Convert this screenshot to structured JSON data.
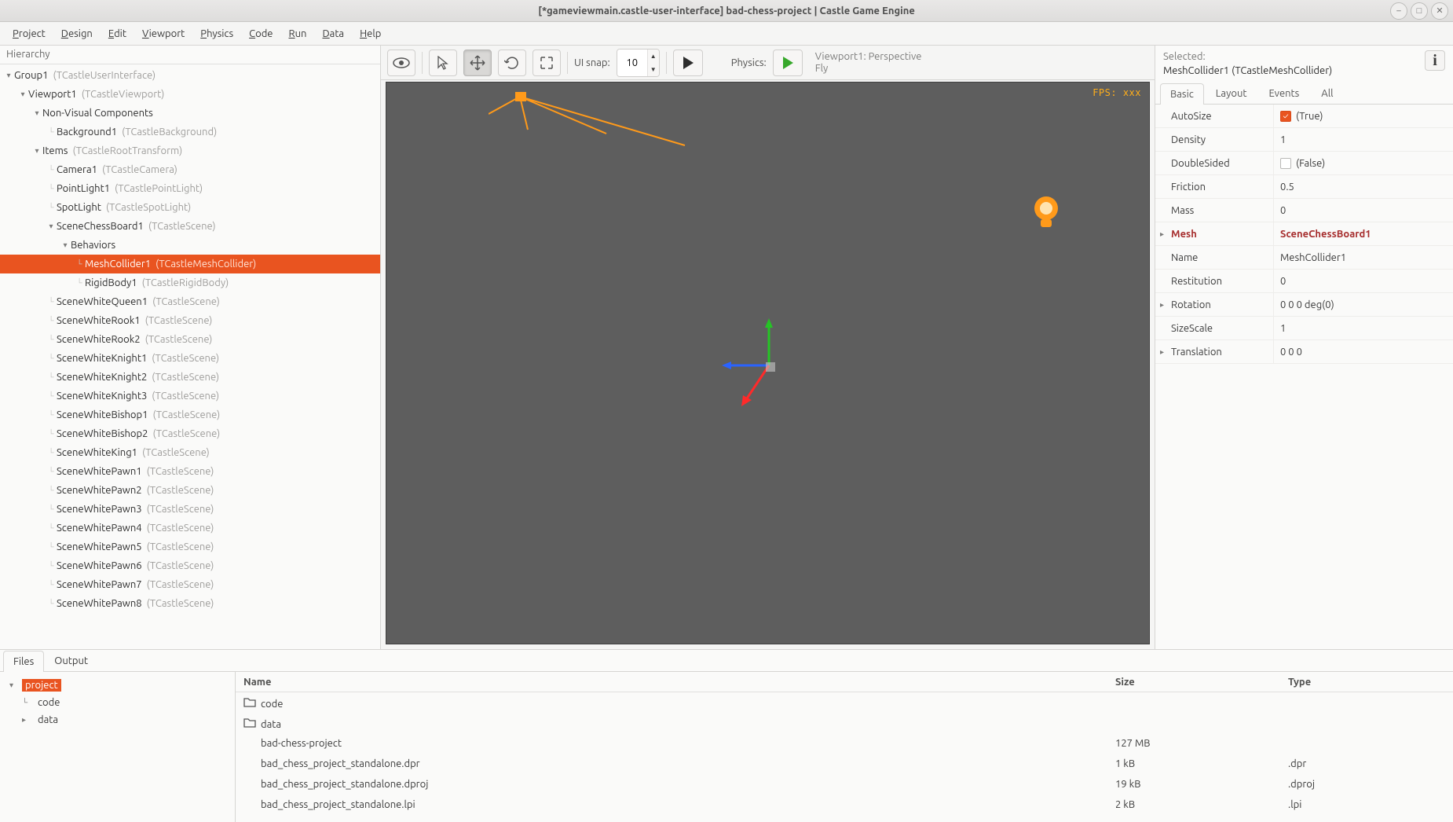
{
  "window": {
    "title": "[*gameviewmain.castle-user-interface] bad-chess-project | Castle Game Engine"
  },
  "menu": [
    "Project",
    "Design",
    "Edit",
    "Viewport",
    "Physics",
    "Code",
    "Run",
    "Data",
    "Help"
  ],
  "hierarchy": {
    "title": "Hierarchy",
    "nodes": [
      {
        "d": 0,
        "tg": true,
        "n": "Group1",
        "t": "(TCastleUserInterface)"
      },
      {
        "d": 1,
        "tg": true,
        "n": "Viewport1",
        "t": "(TCastleViewport)"
      },
      {
        "d": 2,
        "tg": true,
        "n": "Non-Visual Components",
        "t": ""
      },
      {
        "d": 3,
        "tg": false,
        "leaf": true,
        "n": "Background1",
        "t": "(TCastleBackground)"
      },
      {
        "d": 2,
        "tg": true,
        "n": "Items",
        "t": "(TCastleRootTransform)"
      },
      {
        "d": 3,
        "tg": false,
        "leaf": true,
        "n": "Camera1",
        "t": "(TCastleCamera)"
      },
      {
        "d": 3,
        "tg": false,
        "leaf": true,
        "n": "PointLight1",
        "t": "(TCastlePointLight)"
      },
      {
        "d": 3,
        "tg": false,
        "leaf": true,
        "n": "SpotLight",
        "t": "(TCastleSpotLight)"
      },
      {
        "d": 3,
        "tg": true,
        "n": "SceneChessBoard1",
        "t": "(TCastleScene)"
      },
      {
        "d": 4,
        "tg": true,
        "n": "Behaviors",
        "t": ""
      },
      {
        "d": 5,
        "tg": false,
        "leaf": true,
        "sel": true,
        "n": "MeshCollider1",
        "t": "(TCastleMeshCollider)"
      },
      {
        "d": 5,
        "tg": false,
        "leaf": true,
        "n": "RigidBody1",
        "t": "(TCastleRigidBody)"
      },
      {
        "d": 3,
        "tg": false,
        "leaf": true,
        "n": "SceneWhiteQueen1",
        "t": "(TCastleScene)"
      },
      {
        "d": 3,
        "tg": false,
        "leaf": true,
        "n": "SceneWhiteRook1",
        "t": "(TCastleScene)"
      },
      {
        "d": 3,
        "tg": false,
        "leaf": true,
        "n": "SceneWhiteRook2",
        "t": "(TCastleScene)"
      },
      {
        "d": 3,
        "tg": false,
        "leaf": true,
        "n": "SceneWhiteKnight1",
        "t": "(TCastleScene)"
      },
      {
        "d": 3,
        "tg": false,
        "leaf": true,
        "n": "SceneWhiteKnight2",
        "t": "(TCastleScene)"
      },
      {
        "d": 3,
        "tg": false,
        "leaf": true,
        "n": "SceneWhiteKnight3",
        "t": "(TCastleScene)"
      },
      {
        "d": 3,
        "tg": false,
        "leaf": true,
        "n": "SceneWhiteBishop1",
        "t": "(TCastleScene)"
      },
      {
        "d": 3,
        "tg": false,
        "leaf": true,
        "n": "SceneWhiteBishop2",
        "t": "(TCastleScene)"
      },
      {
        "d": 3,
        "tg": false,
        "leaf": true,
        "n": "SceneWhiteKing1",
        "t": "(TCastleScene)"
      },
      {
        "d": 3,
        "tg": false,
        "leaf": true,
        "n": "SceneWhitePawn1",
        "t": "(TCastleScene)"
      },
      {
        "d": 3,
        "tg": false,
        "leaf": true,
        "n": "SceneWhitePawn2",
        "t": "(TCastleScene)"
      },
      {
        "d": 3,
        "tg": false,
        "leaf": true,
        "n": "SceneWhitePawn3",
        "t": "(TCastleScene)"
      },
      {
        "d": 3,
        "tg": false,
        "leaf": true,
        "n": "SceneWhitePawn4",
        "t": "(TCastleScene)"
      },
      {
        "d": 3,
        "tg": false,
        "leaf": true,
        "n": "SceneWhitePawn5",
        "t": "(TCastleScene)"
      },
      {
        "d": 3,
        "tg": false,
        "leaf": true,
        "n": "SceneWhitePawn6",
        "t": "(TCastleScene)"
      },
      {
        "d": 3,
        "tg": false,
        "leaf": true,
        "n": "SceneWhitePawn7",
        "t": "(TCastleScene)"
      },
      {
        "d": 3,
        "tg": false,
        "leaf": true,
        "n": "SceneWhitePawn8",
        "t": "(TCastleScene)"
      }
    ]
  },
  "toolbar": {
    "ui_snap_label": "UI snap:",
    "ui_snap_value": "10",
    "physics_label": "Physics:",
    "vp_info_line1": "Viewport1: Perspective",
    "vp_info_line2": "Fly"
  },
  "viewport": {
    "fps_label": "FPS: xxx",
    "scene_hint": ""
  },
  "inspector": {
    "selected_label": "Selected:",
    "selected_value": "MeshCollider1 (TCastleMeshCollider)",
    "tabs": [
      "Basic",
      "Layout",
      "Events",
      "All"
    ],
    "props": [
      {
        "n": "AutoSize",
        "v": "(True)",
        "chk": true,
        "chkon": true
      },
      {
        "n": "Density",
        "v": "1"
      },
      {
        "n": "DoubleSided",
        "v": "(False)",
        "chk": true,
        "chkon": false
      },
      {
        "n": "Friction",
        "v": "0.5"
      },
      {
        "n": "Mass",
        "v": "0"
      },
      {
        "n": "Mesh",
        "v": "SceneChessBoard1",
        "hl": true,
        "exp": true
      },
      {
        "n": "Name",
        "v": "MeshCollider1"
      },
      {
        "n": "Restitution",
        "v": "0"
      },
      {
        "n": "Rotation",
        "v": "0 0 0 deg(0)",
        "exp": true
      },
      {
        "n": "SizeScale",
        "v": "1"
      },
      {
        "n": "Translation",
        "v": "0 0 0",
        "exp": true
      }
    ]
  },
  "bottom": {
    "tabs": [
      "Files",
      "Output"
    ],
    "folders": [
      {
        "d": 0,
        "n": "project",
        "sel": true
      },
      {
        "d": 1,
        "n": "code",
        "leaf": true
      },
      {
        "d": 1,
        "n": "data",
        "exp": true
      }
    ],
    "headers": {
      "name": "Name",
      "size": "Size",
      "type": "Type"
    },
    "files": [
      {
        "n": "code",
        "folder": true,
        "s": "",
        "t": ""
      },
      {
        "n": "data",
        "folder": true,
        "s": "",
        "t": ""
      },
      {
        "n": "bad-chess-project",
        "s": "127 MB",
        "t": ""
      },
      {
        "n": "bad_chess_project_standalone.dpr",
        "s": "1 kB",
        "t": ".dpr"
      },
      {
        "n": "bad_chess_project_standalone.dproj",
        "s": "19 kB",
        "t": ".dproj"
      },
      {
        "n": "bad_chess_project_standalone.lpi",
        "s": "2 kB",
        "t": ".lpi"
      }
    ]
  },
  "colors": {
    "accent": "#e95420"
  }
}
